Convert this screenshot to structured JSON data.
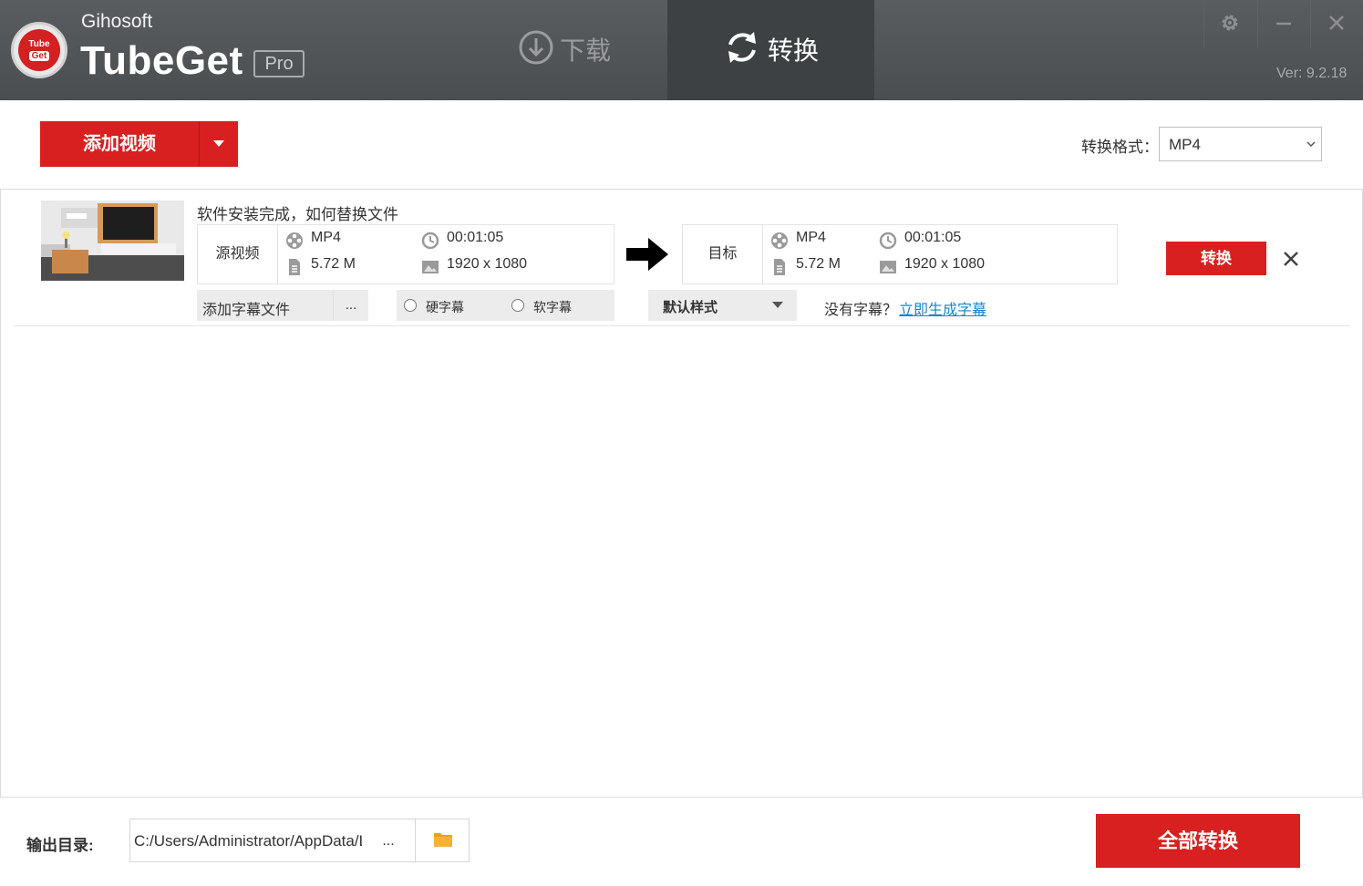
{
  "app": {
    "brand_small": "Gihosoft",
    "brand_name": "TubeGet",
    "edition_badge": "Pro",
    "logo_text_top": "Tube",
    "logo_text_bottom": "Get",
    "version": "Ver: 9.2.18"
  },
  "tabs": [
    {
      "label": "下载",
      "icon": "download-circle-icon",
      "active": false
    },
    {
      "label": "转换",
      "icon": "convert-refresh-icon",
      "active": true
    }
  ],
  "window_controls": [
    "gear-icon",
    "minimize-icon",
    "close-icon"
  ],
  "toolbar": {
    "add_video_label": "添加视频",
    "format_label": "转换格式：",
    "format_value": "MP4"
  },
  "item": {
    "title": "软件安装完成，如何替换文件",
    "source": {
      "tag": "源视频",
      "format": "MP4",
      "duration": "00:01:05",
      "size": "5.72 M",
      "resolution": "1920 x 1080"
    },
    "target": {
      "tag": "目标",
      "format": "MP4",
      "duration": "00:01:05",
      "size": "5.72 M",
      "resolution": "1920 x 1080"
    },
    "convert_label": "转换",
    "subtitle_add_label": "添加字幕文件",
    "subtitle_more": "...",
    "hard_sub_label": "硬字幕",
    "soft_sub_label": "软字幕",
    "style_label": "默认样式",
    "no_subtitle_text": "没有字幕？",
    "generate_link": "立即生成字幕"
  },
  "footer": {
    "output_label": "输出目录:",
    "output_path": "C:/Users/Administrator/AppData/Local",
    "browse_more": "...",
    "convert_all_label": "全部转换"
  },
  "colors": {
    "accent_red": "#d7201f",
    "header_bg": "#4f5255",
    "link_blue": "#1a84c9",
    "folder_orange": "#f0a020"
  }
}
